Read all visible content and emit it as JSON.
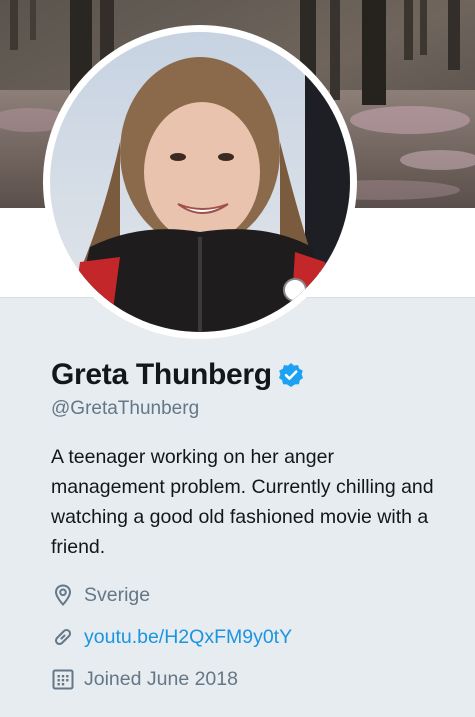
{
  "profile": {
    "name": "Greta Thunberg",
    "handle": "@GretaThunberg",
    "bio": "A teenager working on her anger management problem. Currently chilling and watching a good old fashioned movie with a friend.",
    "location": "Sverige",
    "website": "youtu.be/H2QxFM9y0tY",
    "joined": "Joined June 2018",
    "verified": true
  },
  "icons": {
    "verified": "verified-badge-icon",
    "location": "location-pin-icon",
    "link": "link-icon",
    "calendar": "calendar-icon"
  },
  "colors": {
    "background": "#e6ecf0",
    "name": "#14171a",
    "secondary": "#657786",
    "link": "#1b95e0",
    "verified": "#1da1f2"
  }
}
